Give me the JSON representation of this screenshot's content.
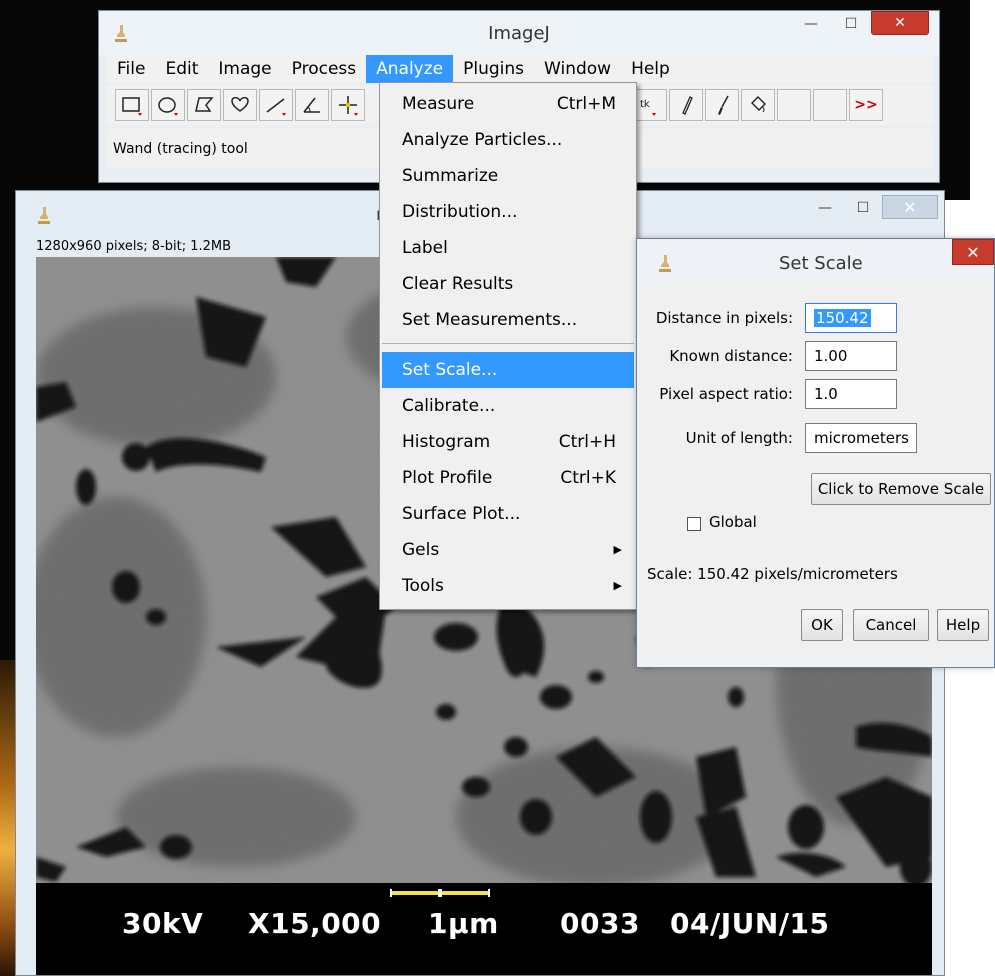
{
  "main_window": {
    "title": "ImageJ",
    "menus": [
      "File",
      "Edit",
      "Image",
      "Process",
      "Analyze",
      "Plugins",
      "Window",
      "Help"
    ],
    "active_menu": "Analyze",
    "status": "Wand (tracing) tool",
    "more_tools": ">>"
  },
  "image_window": {
    "title": "m",
    "info": "1280x960 pixels; 8-bit; 1.2MB",
    "sem_overlay": {
      "voltage": "30kV",
      "magnification": "X15,000",
      "scale_label": "1µm",
      "frame": "0033",
      "date": "04/JUN/15"
    }
  },
  "analyze_menu": {
    "items": [
      {
        "label": "Measure",
        "shortcut": "Ctrl+M"
      },
      {
        "label": "Analyze Particles...",
        "shortcut": ""
      },
      {
        "label": "Summarize",
        "shortcut": ""
      },
      {
        "label": "Distribution...",
        "shortcut": ""
      },
      {
        "label": "Label",
        "shortcut": ""
      },
      {
        "label": "Clear Results",
        "shortcut": ""
      },
      {
        "label": "Set Measurements...",
        "shortcut": ""
      },
      {
        "label": "Set Scale...",
        "shortcut": "",
        "highlighted": true
      },
      {
        "label": "Calibrate...",
        "shortcut": ""
      },
      {
        "label": "Histogram",
        "shortcut": "Ctrl+H"
      },
      {
        "label": "Plot Profile",
        "shortcut": "Ctrl+K"
      },
      {
        "label": "Surface Plot...",
        "shortcut": ""
      },
      {
        "label": "Gels",
        "shortcut": "",
        "submenu": true
      },
      {
        "label": "Tools",
        "shortcut": "",
        "submenu": true
      }
    ]
  },
  "set_scale_dialog": {
    "title": "Set Scale",
    "distance_label": "Distance in pixels:",
    "distance_value": "150.42",
    "known_label": "Known distance:",
    "known_value": "1.00",
    "aspect_label": "Pixel aspect ratio:",
    "aspect_value": "1.0",
    "unit_label": "Unit of length:",
    "unit_value": "micrometers",
    "remove_scale_button": "Click to Remove Scale",
    "global_label": "Global",
    "global_checked": false,
    "scale_text": "Scale: 150.42 pixels/micrometers",
    "ok_button": "OK",
    "cancel_button": "Cancel",
    "help_button": "Help"
  },
  "colors": {
    "menu_highlight": "#3399ff",
    "close_button": "#c73b2d"
  }
}
